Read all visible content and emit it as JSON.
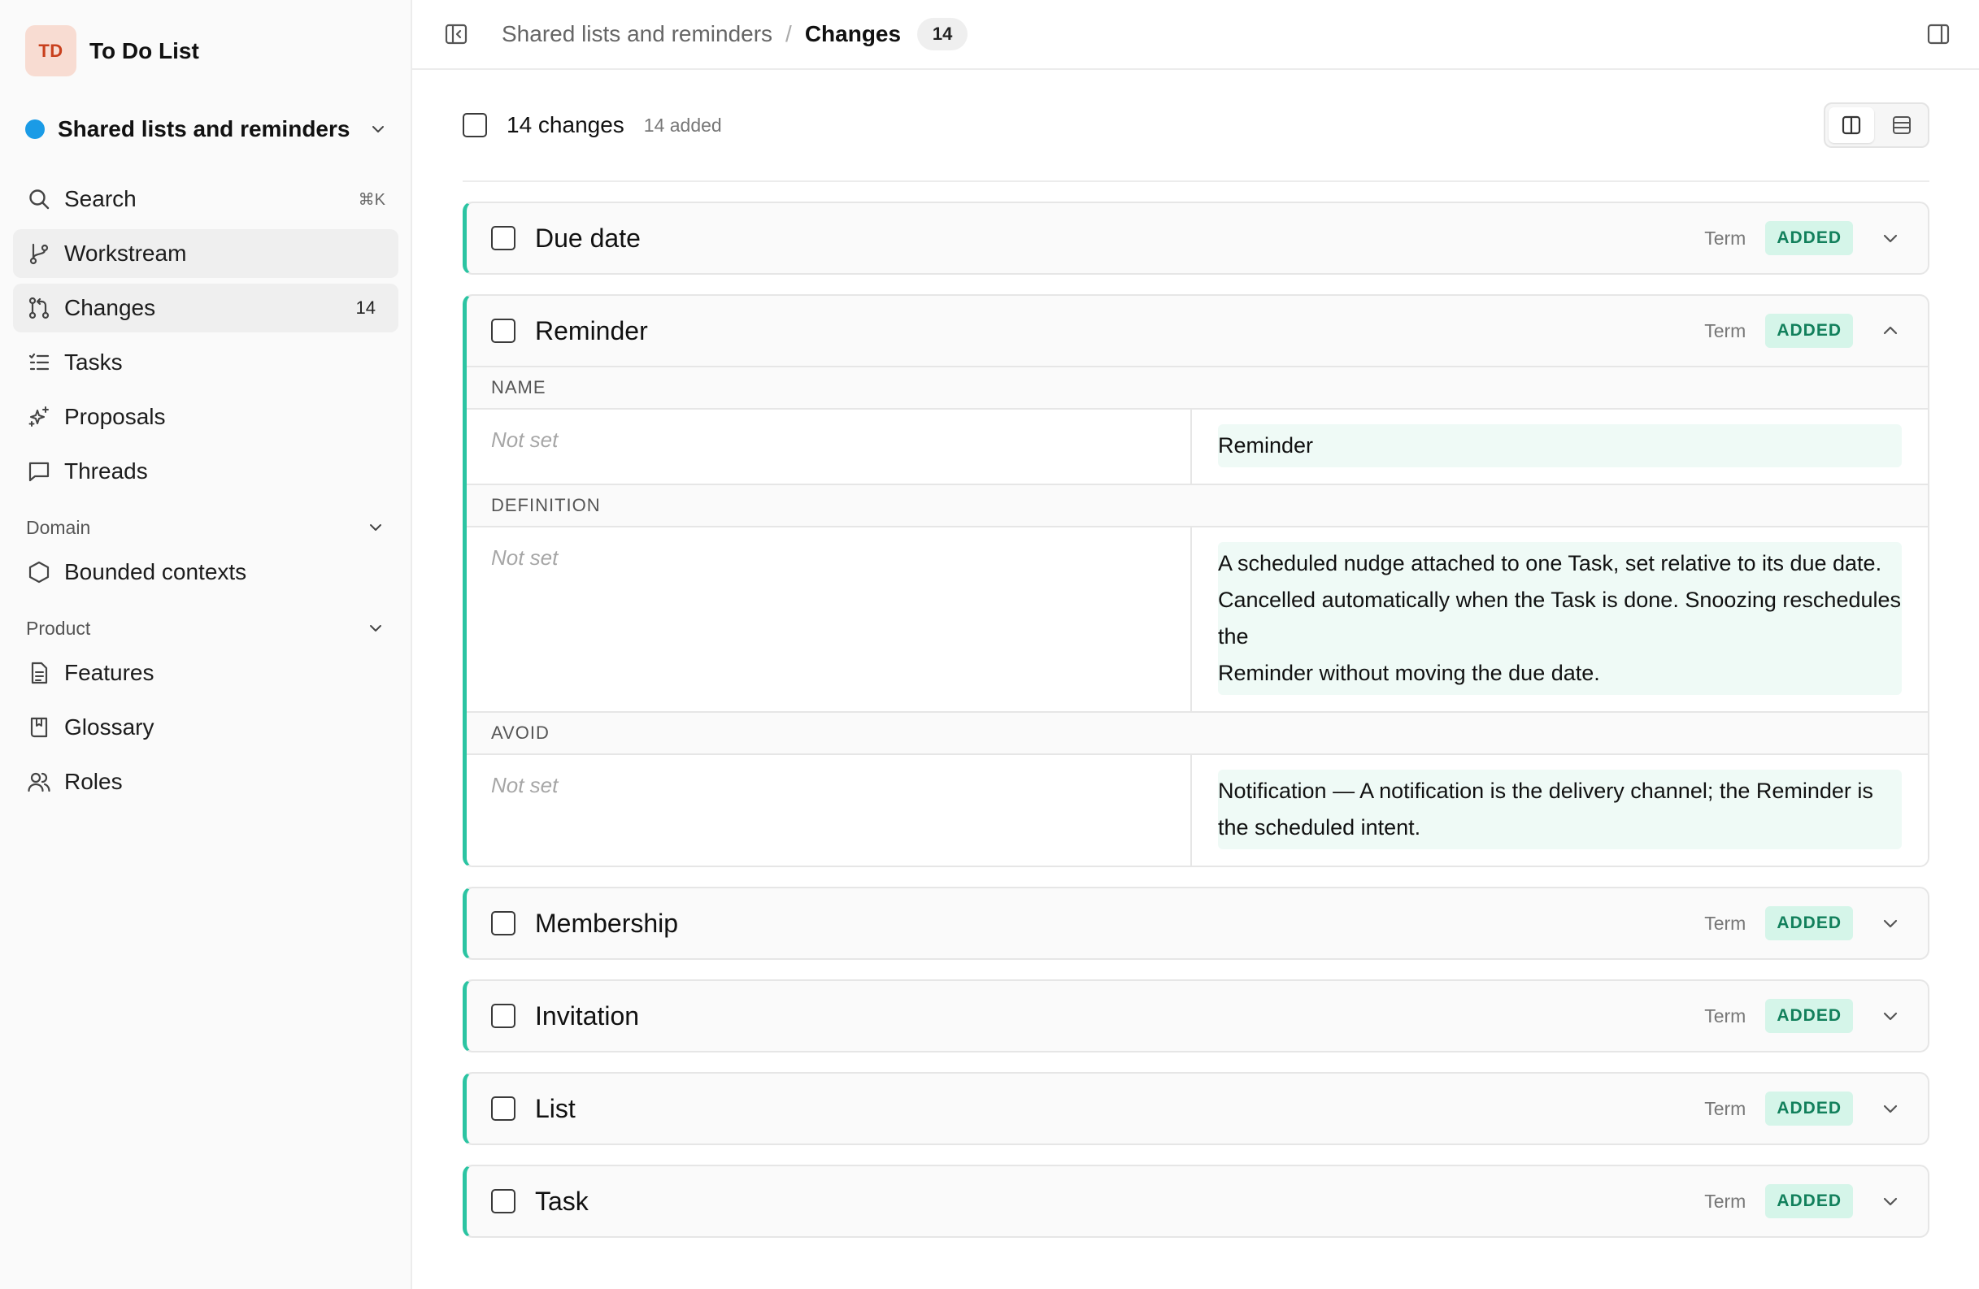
{
  "workspace": {
    "initials": "TD",
    "name": "To Do List"
  },
  "project": {
    "name": "Shared lists and reminders"
  },
  "nav": {
    "search": {
      "label": "Search",
      "shortcut": "⌘K"
    },
    "workstream": {
      "label": "Workstream"
    },
    "changes": {
      "label": "Changes",
      "count": "14"
    },
    "tasks": {
      "label": "Tasks"
    },
    "proposals": {
      "label": "Proposals"
    },
    "threads": {
      "label": "Threads"
    }
  },
  "domain_section": {
    "title": "Domain",
    "items": [
      {
        "label": "Bounded contexts"
      }
    ]
  },
  "product_section": {
    "title": "Product",
    "items": [
      {
        "label": "Features"
      },
      {
        "label": "Glossary"
      },
      {
        "label": "Roles"
      }
    ]
  },
  "breadcrumb": {
    "parent": "Shared lists and reminders",
    "separator": "/",
    "current": "Changes",
    "count": "14"
  },
  "summary": {
    "count_label": "14 changes",
    "added_label": "14 added"
  },
  "labels": {
    "term": "Term",
    "added": "ADDED",
    "not_set": "Not set"
  },
  "changes": [
    {
      "title": "Due date",
      "type": "Term",
      "status": "ADDED",
      "expanded": false
    },
    {
      "title": "Reminder",
      "type": "Term",
      "status": "ADDED",
      "expanded": true,
      "fields": [
        {
          "label": "NAME",
          "old": "Not set",
          "new": [
            "Reminder"
          ]
        },
        {
          "label": "DEFINITION",
          "old": "Not set",
          "new": [
            "A scheduled nudge attached to one Task, set relative to its due date.",
            "Cancelled automatically when the Task is done. Snoozing reschedules the",
            "Reminder without moving the due date."
          ]
        },
        {
          "label": "AVOID",
          "old": "Not set",
          "new": [
            "Notification — A notification is the delivery channel; the Reminder is the scheduled intent."
          ]
        }
      ]
    },
    {
      "title": "Membership",
      "type": "Term",
      "status": "ADDED",
      "expanded": false
    },
    {
      "title": "Invitation",
      "type": "Term",
      "status": "ADDED",
      "expanded": false
    },
    {
      "title": "List",
      "type": "Term",
      "status": "ADDED",
      "expanded": false
    },
    {
      "title": "Task",
      "type": "Term",
      "status": "ADDED",
      "expanded": false
    }
  ],
  "colors": {
    "accent_border": "#2bc4a2",
    "added_bg": "#d5f5e9",
    "added_text": "#12805c",
    "project_dot": "#1a9be6",
    "avatar_bg": "#f8dcd2",
    "avatar_text": "#c9401d"
  },
  "icons": {
    "sidebar_toggle": "sidebar-collapse-icon",
    "right_panel": "right-panel-icon",
    "view_split": "split-view-icon",
    "view_unified": "unified-view-icon"
  }
}
